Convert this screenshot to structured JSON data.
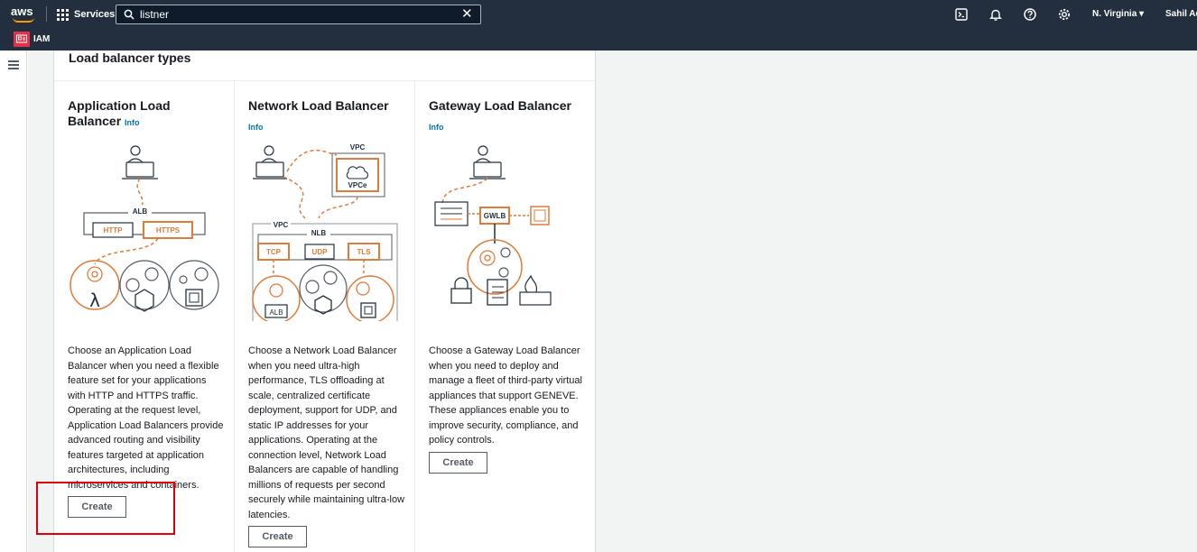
{
  "topnav": {
    "logo_text": "aws",
    "services_label": "Services",
    "search_value": "listner",
    "region_label": "N. Virginia ▾",
    "user_label": "Sahil Ad",
    "icons": [
      "cloudshell-icon",
      "bell-icon",
      "help-icon",
      "settings-icon"
    ]
  },
  "subbar": {
    "service_label": "IAM"
  },
  "page": {
    "section_title": "Load balancer types"
  },
  "cards": [
    {
      "title": "Application Load Balancer",
      "info": "Info",
      "description": "Choose an Application Load Balancer when you need a flexible feature set for your applications with HTTP and HTTPS traffic. Operating at the request level, Application Load Balancers provide advanced routing and visibility features targeted at application architectures, including microservices and containers.",
      "button": "Create",
      "diagram": {
        "lb": "ALB",
        "listeners": [
          "HTTP",
          "HTTPS"
        ]
      }
    },
    {
      "title": "Network Load Balancer",
      "info": "Info",
      "description": "Choose a Network Load Balancer when you need ultra-high performance, TLS offloading at scale, centralized certificate deployment, support for UDP, and static IP addresses for your applications. Operating at the connection level, Network Load Balancers are capable of handling millions of requests per second securely while maintaining ultra-low latencies.",
      "button": "Create",
      "diagram": {
        "vpc_top": "VPC",
        "vpce": "VPCe",
        "vpc_main": "VPC",
        "lb": "NLB",
        "listeners": [
          "TCP",
          "UDP",
          "TLS"
        ],
        "target": "ALB"
      }
    },
    {
      "title": "Gateway Load Balancer",
      "info": "Info",
      "description": "Choose a Gateway Load Balancer when you need to deploy and manage a fleet of third-party virtual appliances that support GENEVE. These appliances enable you to improve security, compliance, and policy controls.",
      "button": "Create",
      "diagram": {
        "lb": "GWLB"
      }
    }
  ],
  "colors": {
    "nav_bg": "#232f3e",
    "accent_orange": "#e07b39",
    "link_blue": "#0073bb",
    "highlight_red": "#e0000b"
  }
}
